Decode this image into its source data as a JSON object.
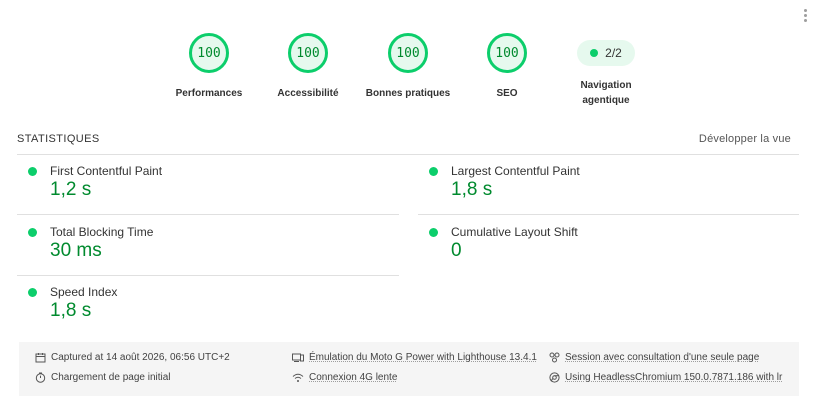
{
  "gauges": [
    {
      "score": "100",
      "label": "Performances"
    },
    {
      "score": "100",
      "label": "Accessibilité"
    },
    {
      "score": "100",
      "label": "Bonnes pratiques"
    },
    {
      "score": "100",
      "label": "SEO"
    }
  ],
  "agentic": {
    "value": "2/2",
    "label_line1": "Navigation",
    "label_line2": "agentique"
  },
  "stats": {
    "title": "STATISTIQUES",
    "expand": "Développer la vue"
  },
  "metrics": [
    {
      "name": "First Contentful Paint",
      "value": "1,2 s",
      "status": "pass"
    },
    {
      "name": "Largest Contentful Paint",
      "value": "1,8 s",
      "status": "pass"
    },
    {
      "name": "Total Blocking Time",
      "value": "30 ms",
      "status": "pass"
    },
    {
      "name": "Cumulative Layout Shift",
      "value": "0",
      "status": "pass"
    },
    {
      "name": "Speed Index",
      "value": "1,8 s",
      "status": "pass"
    }
  ],
  "footer": {
    "captured": "Captured at 14 août 2026, 06:56 UTC+2",
    "load": "Chargement de page initial",
    "emulation": "Émulation du Moto G Power with Lighthouse 13.4.1",
    "connection": "Connexion 4G lente",
    "session": "Session avec consultation d'une seule page",
    "browser": "Using HeadlessChromium 150.0.7871.186 with lr"
  },
  "colors": {
    "pass": "#0cce6b",
    "pass_text": "#008a2e",
    "gauge_bg": "#e6f9ee"
  }
}
